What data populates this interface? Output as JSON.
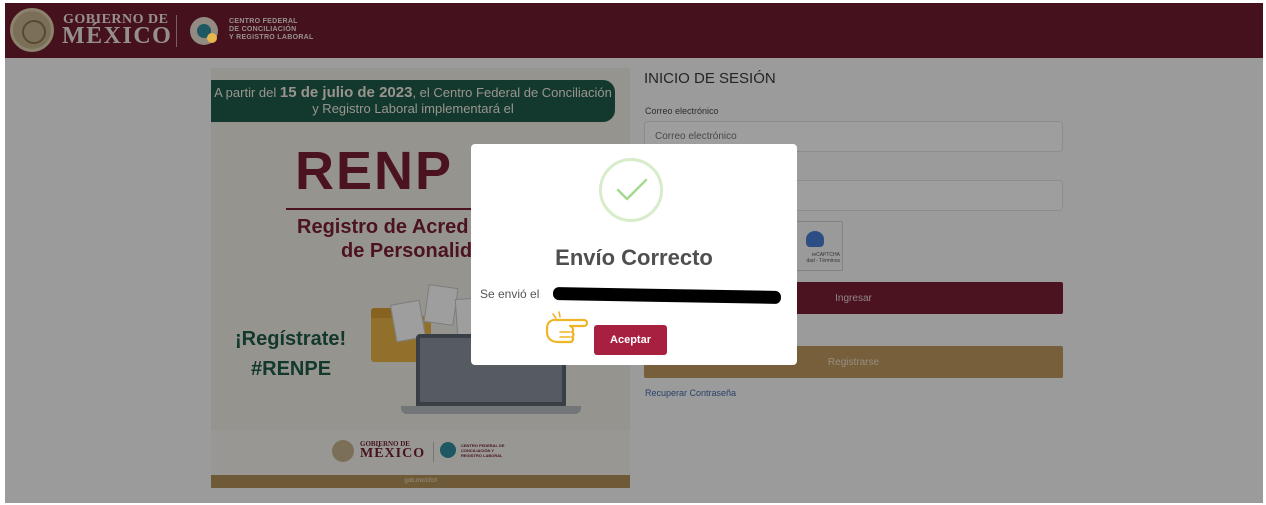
{
  "header": {
    "gob_line1": "GOBIERNO DE",
    "gob_line2": "MÉXICO",
    "cf_line1": "CENTRO FEDERAL",
    "cf_line2": "DE CONCILIACIÓN",
    "cf_line3": "Y REGISTRO LABORAL",
    "background_color": "#6f1c2e"
  },
  "banner": {
    "top_text_pre": "A partir del ",
    "top_text_date": "15 de julio de 2023",
    "top_text_post": ", el Centro Federal de Conciliación y Registro Laboral implementará el",
    "headline": "RENP",
    "subtitle_line1": "Registro de Acred",
    "subtitle_line2": "de Personalid",
    "cta": "¡Regístrate!",
    "hashtag": "#RENPE",
    "footer_gob_line1": "GOBIERNO DE",
    "footer_gob_line2": "MÉXICO",
    "footer_cf": "CENTRO FEDERAL DE CONCILIACIÓN Y REGISTRO LABORAL",
    "footer_bar": "gob.mx/cfcrl"
  },
  "login": {
    "title": "INICIO DE SESIÓN",
    "email_label": "Correo electrónico",
    "email_placeholder": "Correo electrónico",
    "captcha_text": "reCAPTCHA\ndad - Términos",
    "ingresar_label": "Ingresar",
    "registrarse_label": "Registrarse",
    "recover_link": "Recuperar Contraseña",
    "accent_color": "#7a1f33",
    "secondary_color": "#bf9a5e"
  },
  "modal": {
    "title": "Envío Correcto",
    "message": "Se envió el",
    "accept_label": "Aceptar",
    "icon": "check-circle-icon",
    "pointer_icon": "pointing-hand-icon",
    "accept_color": "#a82040"
  }
}
